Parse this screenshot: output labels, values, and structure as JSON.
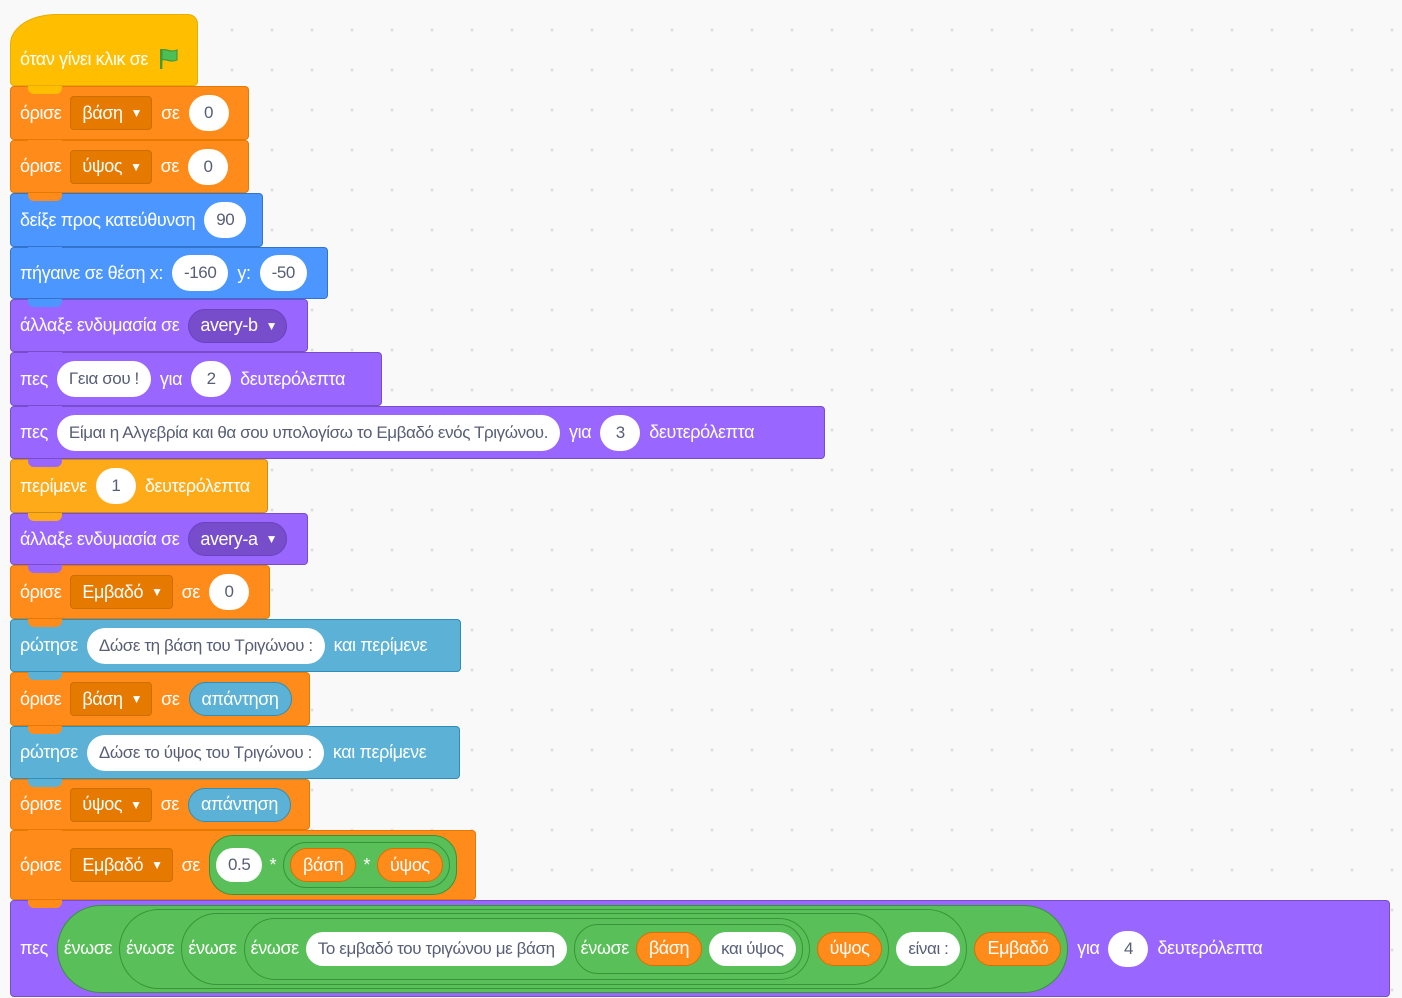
{
  "blocks": {
    "b1": {
      "label": "όταν γίνει κλικ σε"
    },
    "b2": {
      "label": "όρισε",
      "variable": "βάση",
      "to": "σε",
      "value": "0"
    },
    "b3": {
      "label": "όρισε",
      "variable": "ύψος",
      "to": "σε",
      "value": "0"
    },
    "b4": {
      "label": "δείξε προς κατεύθυνση",
      "value": "90"
    },
    "b5": {
      "label": "πήγαινε σε θέση x:",
      "x": "-160",
      "ylabel": "y:",
      "y": "-50"
    },
    "b6": {
      "label": "άλλαξε ενδυμασία σε",
      "costume": "avery-b"
    },
    "b7": {
      "label": "πες",
      "message": "Γεια σου !",
      "for": "για",
      "secs": "2",
      "unit": "δευτερόλεπτα"
    },
    "b8": {
      "label": "πες",
      "message": "Είμαι η Αλγεβρία και θα σου υπολογίσω το Εμβαδό ενός Τριγώνου.",
      "for": "για",
      "secs": "3",
      "unit": "δευτερόλεπτα"
    },
    "b9": {
      "label": "περίμενε",
      "secs": "1",
      "unit": "δευτερόλεπτα"
    },
    "b10": {
      "label": "άλλαξε ενδυμασία σε",
      "costume": "avery-a"
    },
    "b11": {
      "label": "όρισε",
      "variable": "Εμβαδό",
      "to": "σε",
      "value": "0"
    },
    "b12": {
      "label": "ρώτησε",
      "question": "Δώσε τη βάση του Τριγώνου :",
      "wait": "και περίμενε"
    },
    "b13": {
      "label": "όρισε",
      "variable": "βάση",
      "to": "σε",
      "reporter": "απάντηση"
    },
    "b14": {
      "label": "ρώτησε",
      "question": "Δώσε το ύψος του Τριγώνου :",
      "wait": "και περίμενε"
    },
    "b15": {
      "label": "όρισε",
      "variable": "ύψος",
      "to": "σε",
      "reporter": "απάντηση"
    },
    "b16": {
      "label": "όρισε",
      "variable": "Εμβαδό",
      "to": "σε",
      "num": "0.5",
      "times": "*",
      "var1": "βάση",
      "var2": "ύψος"
    },
    "b17": {
      "label": "πες",
      "join": "ένωσε",
      "text1": "Το εμβαδό του τριγώνου με βάση",
      "var_base": "βάση",
      "text2": "και ύψος",
      "var_height": "ύψος",
      "text3": "είναι :",
      "var_area": "Εμβαδό",
      "for": "για",
      "secs": "4",
      "unit": "δευτερόλεπτα"
    }
  },
  "colors": {
    "events": "#FFBF00",
    "variables": "#FF8C1A",
    "motion": "#4C97FF",
    "looks": "#9966FF",
    "control": "#FFAB19",
    "sensing": "#5CB1D6",
    "operators": "#59C059"
  },
  "icons": {
    "flag": "green-flag-icon",
    "dropdown": "dropdown-arrow-icon"
  }
}
